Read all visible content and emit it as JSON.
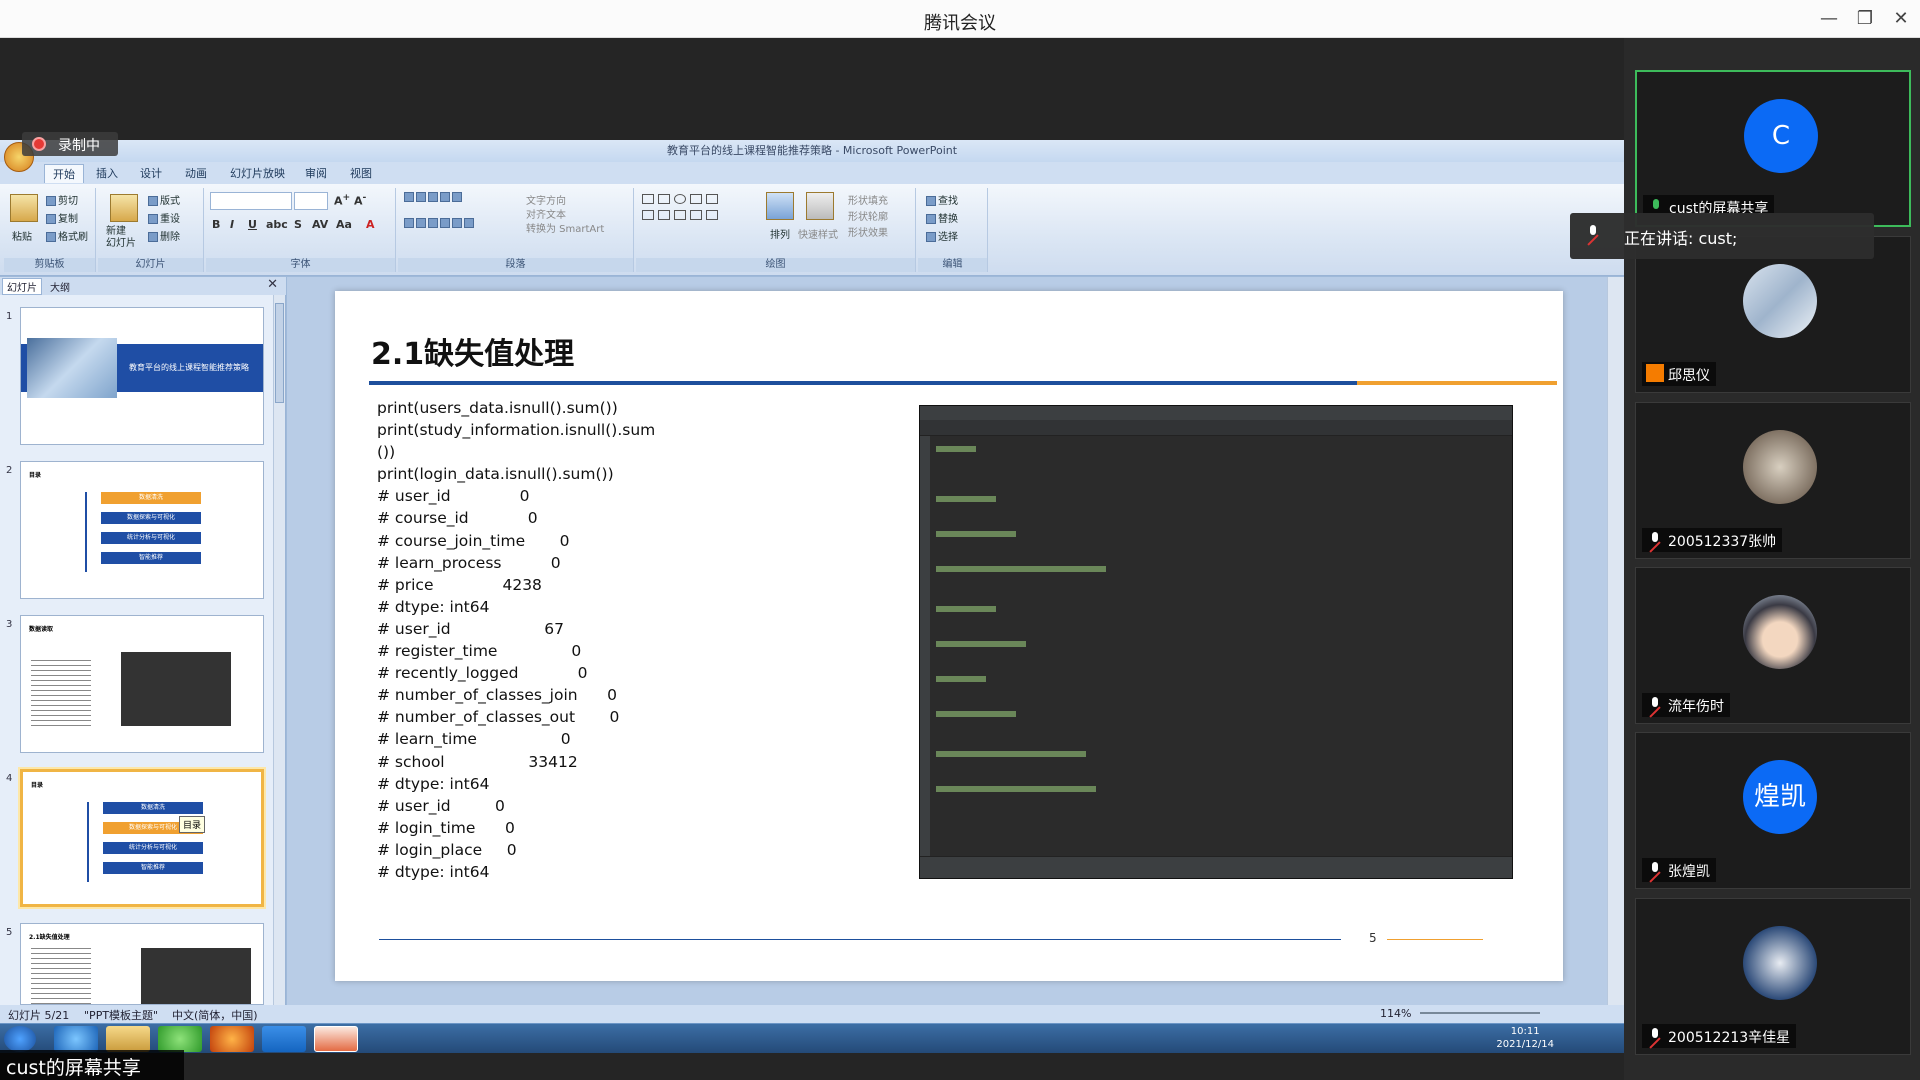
{
  "app": {
    "title": "腾讯会议"
  },
  "recording": {
    "label": "录制中"
  },
  "ppt": {
    "title": "教育平台的线上课程智能推荐策略 - Microsoft PowerPoint",
    "tabs": [
      "开始",
      "插入",
      "设计",
      "动画",
      "幻灯片放映",
      "审阅",
      "视图"
    ],
    "groups": {
      "clipboard": "剪贴板",
      "slides": "幻灯片",
      "font": "字体",
      "paragraph": "段落",
      "drawing": "绘图",
      "editing": "编辑"
    },
    "buttons": {
      "paste": "粘贴",
      "cut": "剪切",
      "copy": "复制",
      "format_painter": "格式刷",
      "new_slide": "新建\n幻灯片",
      "layout": "版式",
      "reset": "重设",
      "delete": "删除",
      "text_dir": "文字方向",
      "align_text": "对齐文本",
      "smartart": "转换为 SmartArt",
      "arrange": "排列",
      "quick_style": "快速样式",
      "shape_fill": "形状填充",
      "shape_outline": "形状轮廓",
      "shape_effect": "形状效果",
      "find": "查找",
      "replace": "替换",
      "select": "选择"
    },
    "panel_tabs": [
      "幻灯片",
      "大纲"
    ],
    "thumbs": [
      {
        "num": "1",
        "title": "教育平台的线上课程智能推荐策略"
      },
      {
        "num": "2",
        "title": "目录",
        "items": [
          "数据清洗",
          "数据探索与可视化",
          "统计分析与可视化",
          "智能推荐"
        ]
      },
      {
        "num": "3",
        "title": "数据读取"
      },
      {
        "num": "4",
        "title": "目录",
        "items": [
          "数据清洗",
          "数据探索与可视化",
          "统计分析与可视化",
          "智能推荐"
        ],
        "tooltip": "目录"
      },
      {
        "num": "5",
        "title": "2.1缺失值处理"
      }
    ],
    "slide": {
      "title": "2.1缺失值处理",
      "code": "print(users_data.isnull().sum())\nprint(study_information.isnull().sum\n())\nprint(login_data.isnull().sum())\n# user_id              0\n# course_id            0\n# course_join_time       0\n# learn_process          0\n# price              4238\n# dtype: int64\n# user_id                   67\n# register_time               0\n# recently_logged            0\n# number_of_classes_join      0\n# number_of_classes_out       0\n# learn_time                 0\n# school                 33412\n# dtype: int64\n# user_id         0\n# login_time      0\n# login_place     0\n# dtype: int64",
      "page_num": "5"
    },
    "status": {
      "slide": "幻灯片 5/21",
      "theme": "\"PPT模板主题\"",
      "lang": "中文(简体，中国)",
      "zoom": "114%"
    },
    "clock": {
      "time": "10:11",
      "date": "2021/12/14"
    }
  },
  "share_label": "cust的屏幕共享",
  "speaking": "正在讲话: cust;",
  "participants": [
    {
      "name": "cust的屏幕共享",
      "avatar": "C",
      "mic": "on",
      "color": "#0b6af5"
    },
    {
      "name": "邱思仪",
      "avatar": "",
      "mic": "user"
    },
    {
      "name": "200512337张帅",
      "avatar": "",
      "mic": "off"
    },
    {
      "name": "流年伤时",
      "avatar": "",
      "mic": "off"
    },
    {
      "name": "张煌凯",
      "avatar": "煌凯",
      "mic": "off",
      "color": "#0b6af5"
    },
    {
      "name": "200512213辛佳星",
      "avatar": "",
      "mic": "off"
    }
  ]
}
